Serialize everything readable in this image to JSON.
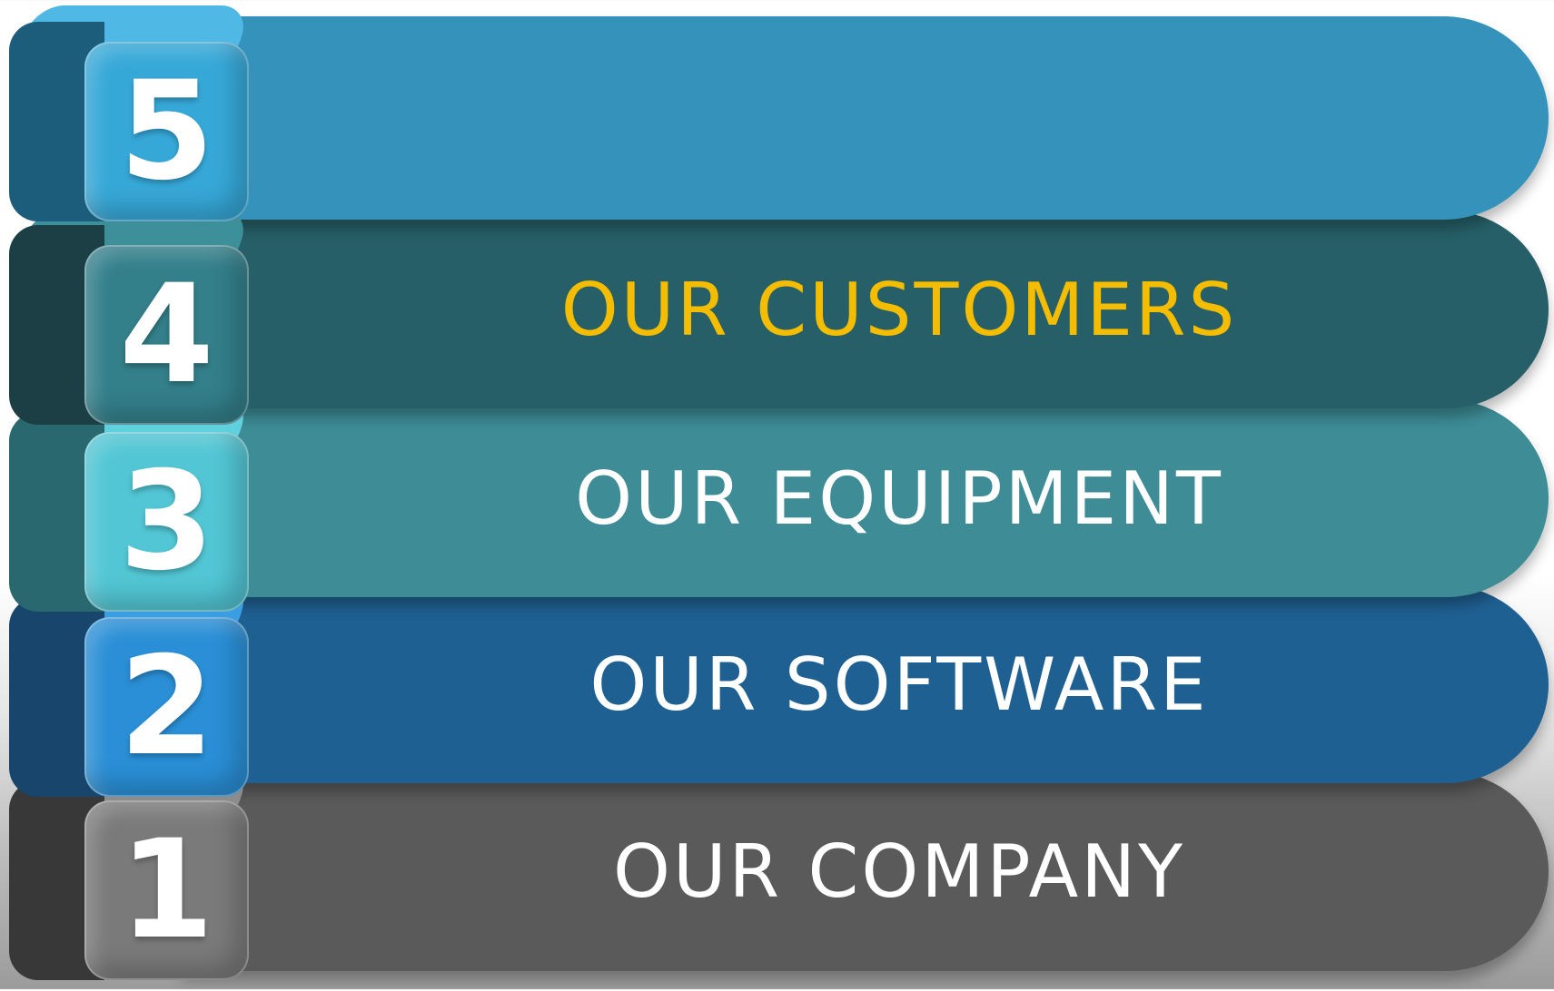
{
  "levels": [
    {
      "number": "5",
      "label": "",
      "label_color": "#ffffff",
      "band_color": "#3593bb",
      "cube_face": "#36a8d8",
      "cube_side": "#1c5d7b",
      "cube_top": "#4fb8e4"
    },
    {
      "number": "4",
      "label": "OUR CUSTOMERS",
      "label_color": "#f5bd00",
      "band_color": "#265f67",
      "cube_face": "#337f8a",
      "cube_side": "#1b3f45",
      "cube_top": "#3d8f99"
    },
    {
      "number": "3",
      "label": "OUR EQUIPMENT",
      "label_color": "#ffffff",
      "band_color": "#3d8c96",
      "cube_face": "#52c6d4",
      "cube_side": "#2a6870",
      "cube_top": "#5fd0dd"
    },
    {
      "number": "2",
      "label": "OUR SOFTWARE",
      "label_color": "#ffffff",
      "band_color": "#1f6092",
      "cube_face": "#2a8fd6",
      "cube_side": "#17456b",
      "cube_top": "#3a9ee2"
    },
    {
      "number": "1",
      "label": "OUR COMPANY",
      "label_color": "#ffffff",
      "band_color": "#5a5a5a",
      "cube_face": "#7a7a7a",
      "cube_side": "#383838",
      "cube_top": "#8c8c8c"
    }
  ]
}
